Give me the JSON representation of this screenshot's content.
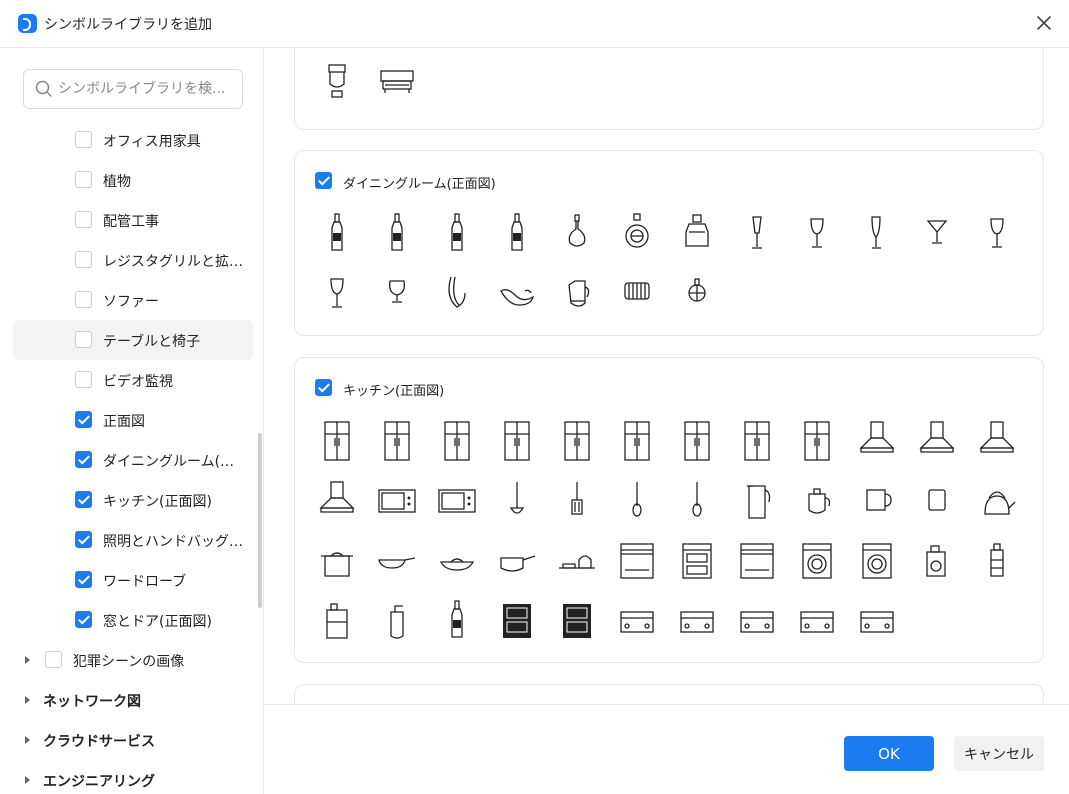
{
  "window": {
    "title": "シンボルライブラリを追加",
    "accent_color": "#1a7cf0"
  },
  "sidebar": {
    "search_placeholder": "シンボルライブラリを検...",
    "items": [
      {
        "label": "オフィス用家具",
        "checked": false
      },
      {
        "label": "植物",
        "checked": false
      },
      {
        "label": "配管工事",
        "checked": false
      },
      {
        "label": "レジスタグリルと拡散器",
        "checked": false
      },
      {
        "label": "ソファー",
        "checked": false
      },
      {
        "label": "テーブルと椅子",
        "checked": false
      },
      {
        "label": "ビデオ監視",
        "checked": false
      },
      {
        "label": "正面図",
        "checked": true
      },
      {
        "label": "ダイニングルーム(正面図)",
        "checked": true
      },
      {
        "label": "キッチン(正面図)",
        "checked": true
      },
      {
        "label": "照明とハンドバッグ(正面図)",
        "checked": true
      },
      {
        "label": "ワードローブ",
        "checked": true
      },
      {
        "label": "窓とドア(正面図)",
        "checked": true
      }
    ],
    "subgroup": {
      "label": "犯罪シーンの画像",
      "checked": false
    },
    "groups": [
      {
        "label": "ネットワーク図"
      },
      {
        "label": "クラウドサービス"
      },
      {
        "label": "エンジニアリング"
      }
    ]
  },
  "main": {
    "top_partial_symbols": [
      "toilet-icon",
      "grill-icon"
    ],
    "sections": [
      {
        "title": "ダイニングルーム(正面図)",
        "checked": true,
        "symbols": [
          "bottle-icon",
          "bottle-icon",
          "bottle-icon",
          "bottle-icon",
          "decanter-icon",
          "cognac-bottle-icon",
          "perfume-bottle-icon",
          "flute-glass-icon",
          "wine-glass-icon",
          "champagne-flute-icon",
          "martini-glass-icon",
          "wine-glass-icon",
          "wine-glass-icon",
          "brandy-glass-icon",
          "wine-aerator-icon",
          "gravy-boat-icon",
          "pitcher-icon",
          "barrel-icon",
          "globe-bottle-icon"
        ]
      },
      {
        "title": "キッチン(正面図)",
        "checked": true,
        "symbols": [
          "fridge-icon",
          "fridge-icon",
          "fridge-icon",
          "fridge-icon",
          "fridge-icon",
          "fridge-icon",
          "fridge-icon",
          "fridge-icon",
          "fridge-icon",
          "range-hood-icon",
          "range-hood-icon",
          "range-hood-icon",
          "range-hood-icon",
          "microwave-icon",
          "microwave-icon",
          "ladle-icon",
          "spatula-icon",
          "spoon-icon",
          "spoon-icon",
          "kettle-jug-icon",
          "teapot-icon",
          "mug-icon",
          "cup-icon",
          "kettle-icon",
          "pot-icon",
          "frying-pan-icon",
          "wok-icon",
          "saucepan-icon",
          "stove-set-icon",
          "dishwasher-icon",
          "oven-icon",
          "dishwasher-icon",
          "washing-machine-icon",
          "washing-machine-icon",
          "detergent-icon",
          "detergent-bottle-icon",
          "jerrycan-icon",
          "soap-dispenser-icon",
          "bottle-icon",
          "cabinet-icon",
          "cabinet-icon",
          "appliance-icon",
          "appliance-icon",
          "appliance-icon",
          "appliance-icon",
          "appliance-icon"
        ]
      }
    ]
  },
  "footer": {
    "ok_label": "OK",
    "cancel_label": "キャンセル"
  }
}
